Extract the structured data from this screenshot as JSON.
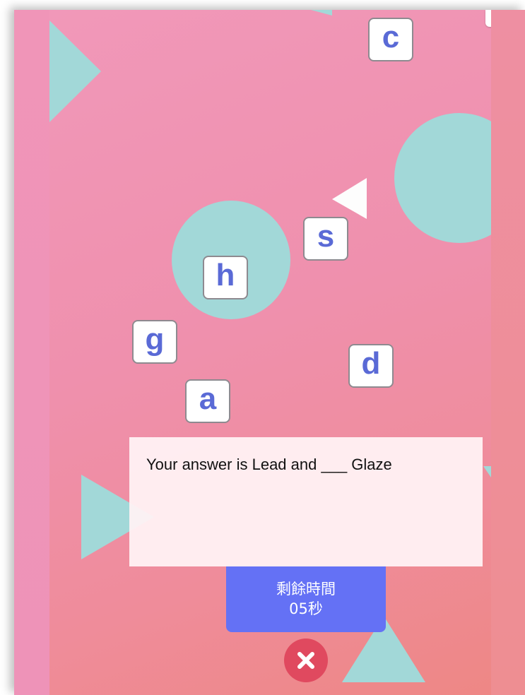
{
  "tiles": [
    {
      "id": "c",
      "letter": "c"
    },
    {
      "id": "s",
      "letter": "s"
    },
    {
      "id": "h",
      "letter": "h"
    },
    {
      "id": "g",
      "letter": "g"
    },
    {
      "id": "d",
      "letter": "d"
    },
    {
      "id": "a",
      "letter": "a"
    }
  ],
  "answer": {
    "text": "Your answer is Lead and ___ Glaze"
  },
  "timer": {
    "label": "剩餘時間",
    "value": "05秒"
  },
  "icons": {
    "back": "undo-arrow-icon",
    "close": "close-x-icon"
  },
  "colors": {
    "background_pink": "#ef90ad",
    "shape_teal": "#a2d8d8",
    "tile_letter": "#5a6ad6",
    "timer_blue": "#6471f5",
    "close_red": "#e0495f"
  }
}
